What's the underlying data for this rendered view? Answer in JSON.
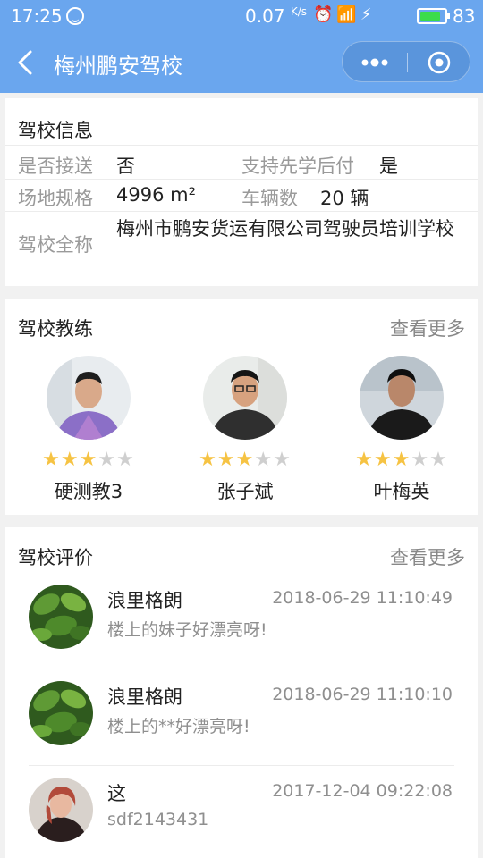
{
  "status_bar": {
    "time": "17:25",
    "speed": "0.07",
    "speed_unit": "K/s",
    "battery_pct": "83",
    "battery_level": 0.83,
    "icons": [
      "face-icon",
      "alarm-icon",
      "wifi-icon",
      "signal-icon",
      "charging-icon"
    ]
  },
  "nav": {
    "title": "梅州鹏安驾校"
  },
  "info": {
    "title": "驾校信息",
    "pickup_label": "是否接送",
    "pickup_value": "否",
    "paylater_label": "支持先学后付",
    "paylater_value": "是",
    "area_label": "场地规格",
    "area_value": "4996 m²",
    "cars_label": "车辆数",
    "cars_value": "20 辆",
    "fullname_label": "驾校全称",
    "fullname_value": "梅州市鹏安货运有限公司驾驶员培训学校"
  },
  "coaches": {
    "title": "驾校教练",
    "more": "查看更多",
    "items": [
      {
        "name": "硬测教3",
        "rating": 3,
        "max": 5
      },
      {
        "name": "张子斌",
        "rating": 3,
        "max": 5
      },
      {
        "name": "叶梅英",
        "rating": 3,
        "max": 5
      }
    ]
  },
  "reviews": {
    "title": "驾校评价",
    "more": "查看更多",
    "items": [
      {
        "user": "浪里格朗",
        "date": "2018-06-29 11:10:49",
        "text": "楼上的妹子好漂亮呀!"
      },
      {
        "user": "浪里格朗",
        "date": "2018-06-29 11:10:10",
        "text": "楼上的**好漂亮呀!"
      },
      {
        "user": "这",
        "date": "2017-12-04 09:22:08",
        "text": "sdf2143431"
      }
    ]
  },
  "colors": {
    "header": "#6aa6ee",
    "star_on": "#f6c343",
    "star_off": "#cfcfcf"
  }
}
